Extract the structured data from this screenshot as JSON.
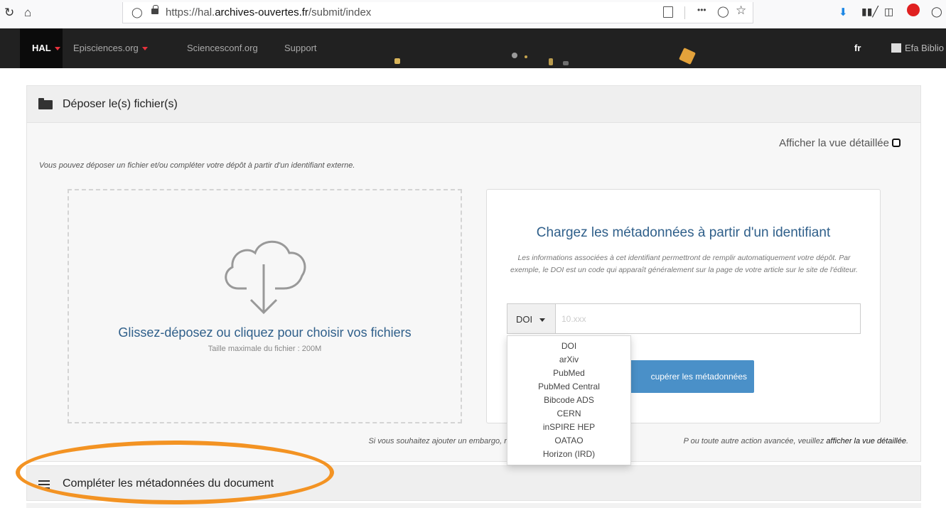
{
  "browser": {
    "url_prefix": "https://hal.",
    "url_domain": "archives-ouvertes.fr",
    "url_path": "/submit/index",
    "menu_dots": "•••"
  },
  "navbar": {
    "hal": "HAL",
    "episciences": "Episciences.org",
    "sciencesconf": "Sciencesconf.org",
    "support": "Support",
    "lang": "fr",
    "user": "Efa Biblio"
  },
  "panel_upload": {
    "title": "Déposer le(s) fichier(s)",
    "detail_toggle": "Afficher la vue détaillée",
    "intro": "Vous pouvez déposer un fichier et/ou compléter votre dépôt à partir d'un identifiant externe.",
    "dropzone_title": "Glissez-déposez ou cliquez pour choisir vos fichiers",
    "dropzone_sub": "Taille maximale du fichier : 200M",
    "id_title": "Chargez les métadonnées à partir d'un identifiant",
    "id_desc": "Les informations associées à cet identifiant permettront de remplir automatiquement votre dépôt. Par exemple, le DOI est un code qui apparaît généralement sur la page de votre article sur le site de l'éditeur.",
    "id_type": "DOI",
    "id_placeholder": "10.xxx",
    "fetch_button": "cupérer les métadonnées",
    "embargo_text": "Si vous souhaitez ajouter un embargo, récupérer de",
    "embargo_text2": "P ou toute autre action avancée, veuillez",
    "embargo_link": "afficher la vue détaillée",
    "embargo_end": "."
  },
  "dropdown": {
    "options": [
      "DOI",
      "arXiv",
      "PubMed",
      "PubMed Central",
      "Bibcode ADS",
      "CERN",
      "inSPIRE HEP",
      "OATAO",
      "Horizon (IRD)"
    ]
  },
  "panel_metadata": {
    "title": "Compléter les métadonnées du document"
  },
  "colors": {
    "accent_blue": "#4a90c8",
    "title_blue": "#2f5f8a",
    "highlight_orange": "#f39323",
    "navbar_bg": "#212121"
  }
}
